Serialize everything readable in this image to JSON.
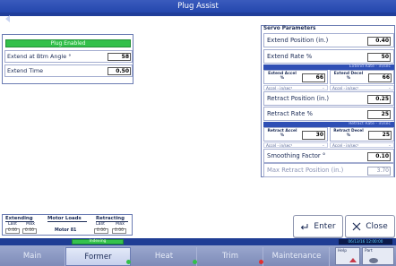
{
  "window": {
    "title": "Plug Assist"
  },
  "left": {
    "plug_enabled": "Plug Enabled",
    "extend_angle_label": "Extend at Btm Angle °",
    "extend_angle_value": "58",
    "extend_time_label": "Extend Time",
    "extend_time_value": "0.50"
  },
  "servo": {
    "title": "Servo Parameters",
    "extend_position_label": "Extend Position (in.)",
    "extend_position_value": "0.40",
    "extend_rate_label": "Extend Rate %",
    "extend_rate_value": "50",
    "extend_rate_bar": "Extend Rate - in/sec",
    "extend_accel_label": "Extend Accel %",
    "extend_accel_value": "66",
    "extend_decel_label": "Extend Decel %",
    "extend_decel_value": "66",
    "accel_units": "Accel - in/sec²",
    "retract_position_label": "Retract Position (in.)",
    "retract_position_value": "0.25",
    "retract_rate_label": "Retract Rate %",
    "retract_rate_value": "25",
    "retract_rate_bar": "Retract Rate - in/sec",
    "retract_accel_label": "Retract Accel %",
    "retract_accel_value": "30",
    "retract_decel_label": "Retract Decel %",
    "retract_decel_value": "25",
    "smoothing_label": "Smoothing Factor °",
    "smoothing_value": "0.10",
    "max_retract_label": "Max Retract Position (in.)",
    "max_retract_value": "3.70"
  },
  "motor": {
    "extending": "Extending",
    "motor_loads": "Motor Loads",
    "retracting": "Retracting",
    "last": "Last",
    "max": "Max",
    "ext_last": "0.00",
    "ext_max": "0.00",
    "motor_name": "Motor 81",
    "ret_last": "0.00",
    "ret_max": "0.00"
  },
  "buttons": {
    "enter": "Enter",
    "close": "Close"
  },
  "status": {
    "indexing": "Indexing",
    "clock": "06/13/16 12:00:00"
  },
  "nav": {
    "tabs": [
      "Main",
      "Former",
      "Heat",
      "Trim",
      "Maintenance"
    ],
    "help": "Help",
    "part": "Part"
  },
  "colors": {
    "title_bar": "#2447ad",
    "status_green": "#33c04a",
    "status_red": "#e03030"
  }
}
